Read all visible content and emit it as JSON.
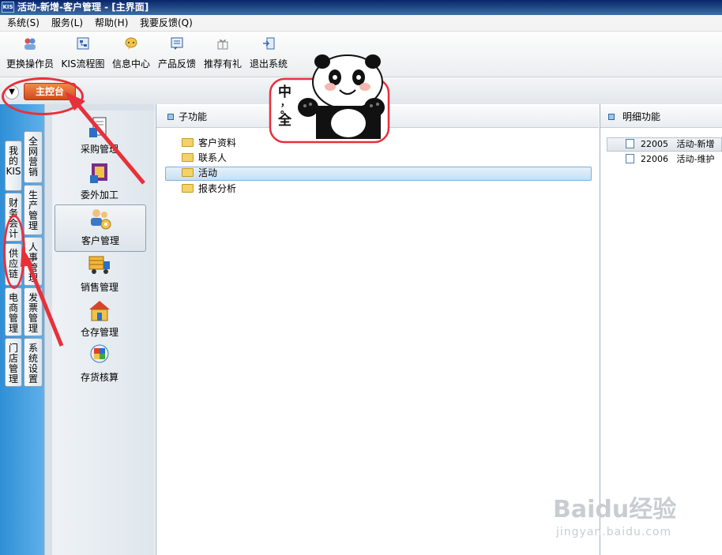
{
  "window": {
    "title": "活动-新增-客户管理 - [主界面]",
    "logo_text": "KIS"
  },
  "menubar": {
    "items": [
      "系统(S)",
      "服务(L)",
      "帮助(H)",
      "我要反馈(Q)"
    ]
  },
  "toolbar": {
    "items": [
      {
        "label": "更换操作员",
        "icon": "users-icon"
      },
      {
        "label": "KIS流程图",
        "icon": "flowchart-icon"
      },
      {
        "label": "信息中心",
        "icon": "info-center-icon"
      },
      {
        "label": "产品反馈",
        "icon": "feedback-icon"
      },
      {
        "label": "推荐有礼",
        "icon": "gift-icon"
      },
      {
        "label": "退出系统",
        "icon": "exit-icon"
      }
    ]
  },
  "tabbar": {
    "main_tab": "主控台"
  },
  "left_tabs": {
    "col1": [
      "我的KIS",
      "财务会计",
      "供应链",
      "电商管理",
      "门店管理"
    ],
    "col2": [
      "全网营销",
      "生产管理",
      "人事管理",
      "发票管理",
      "系统设置"
    ]
  },
  "functions": {
    "items": [
      "采购管理",
      "委外加工",
      "客户管理",
      "销售管理",
      "仓存管理",
      "存货核算"
    ],
    "selected": "客户管理"
  },
  "subfunctions": {
    "header": "子功能",
    "items": [
      "客户资料",
      "联系人",
      "活动",
      "报表分析"
    ],
    "selected": "活动"
  },
  "details": {
    "header": "明细功能",
    "items": [
      {
        "code": "22005",
        "name": "活动-新增"
      },
      {
        "code": "22006",
        "name": "活动-维护"
      }
    ]
  },
  "sticker": {
    "text": [
      "中",
      "，",
      "。",
      "全"
    ]
  },
  "watermark": {
    "brand": "Baidu经验",
    "url": "jingyan.baidu.com"
  },
  "colors": {
    "accent_tab": "#d2491b",
    "selection": "#c7e0f4",
    "annotation": "#e8303a",
    "title_bar": "#0a246a"
  }
}
